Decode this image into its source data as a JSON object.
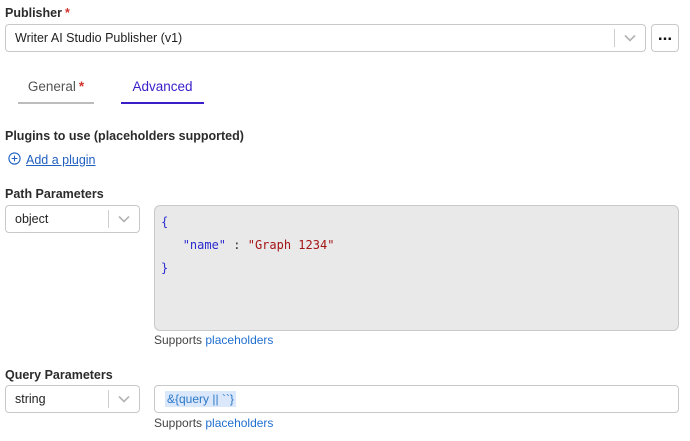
{
  "publisher": {
    "label": "Publisher",
    "required_mark": "*",
    "selected": "Writer AI Studio Publisher (v1)",
    "more_icon": "ellipsis-icon"
  },
  "tabs": [
    {
      "label": "General",
      "required_mark": "*",
      "active": false
    },
    {
      "label": "Advanced",
      "active": true
    }
  ],
  "plugins": {
    "label": "Plugins to use (placeholders supported)",
    "add_label": "Add a plugin",
    "add_icon": "plus-circle-icon"
  },
  "path_parameters": {
    "label": "Path Parameters",
    "type": "object",
    "code": {
      "open": "{",
      "key": "\"name\"",
      "colon": " : ",
      "value": "\"Graph 1234\"",
      "close": "}"
    },
    "supports_prefix": "Supports",
    "supports_link": "placeholders"
  },
  "query_parameters": {
    "label": "Query Parameters",
    "type": "string",
    "value": "&{query || ``}",
    "supports_prefix": "Supports",
    "supports_link": "placeholders"
  },
  "colors": {
    "accent": "#3a1fc9",
    "link": "#1f6fd0",
    "required": "#d0342c"
  }
}
